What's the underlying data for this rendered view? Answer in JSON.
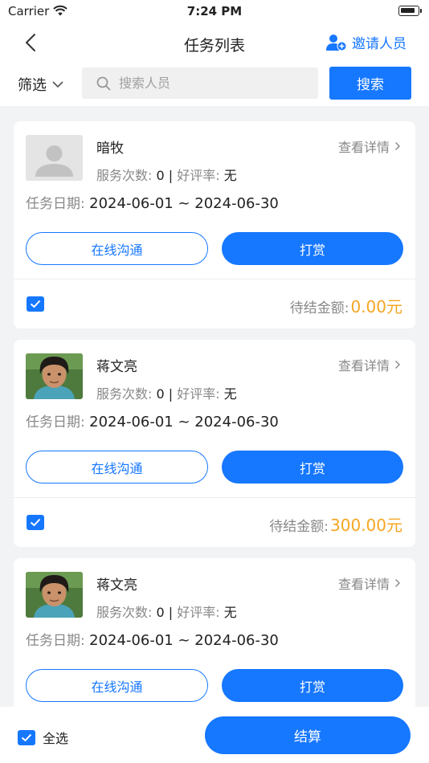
{
  "status_bar": {
    "carrier": "Carrier",
    "time": "7:24 PM"
  },
  "nav": {
    "title": "任务列表",
    "invite_label": "邀请人员"
  },
  "search": {
    "filter_label": "筛选",
    "placeholder": "搜索人员",
    "button_label": "搜索"
  },
  "cards": [
    {
      "name": "暗牧",
      "avatar": "placeholder-avatar",
      "detail_label": "查看详情",
      "stats_service_label": "服务次数:",
      "service_count": "0",
      "separator": "|",
      "stats_rating_label": "好评率:",
      "rating": "无",
      "date_label": "任务日期:",
      "date_range": "2024-06-01 ~ 2024-06-30",
      "chat_label": "在线沟通",
      "reward_label": "打赏",
      "amount_label": "待结金额:",
      "amount": "0.00元",
      "checked": true
    },
    {
      "name": "蒋文亮",
      "avatar": "photo-avatar",
      "detail_label": "查看详情",
      "stats_service_label": "服务次数:",
      "service_count": "0",
      "separator": "|",
      "stats_rating_label": "好评率:",
      "rating": "无",
      "date_label": "任务日期:",
      "date_range": "2024-06-01 ~ 2024-06-30",
      "chat_label": "在线沟通",
      "reward_label": "打赏",
      "amount_label": "待结金额:",
      "amount": "300.00元",
      "checked": true
    },
    {
      "name": "蒋文亮",
      "avatar": "photo-avatar",
      "detail_label": "查看详情",
      "stats_service_label": "服务次数:",
      "service_count": "0",
      "separator": "|",
      "stats_rating_label": "好评率:",
      "rating": "无",
      "date_label": "任务日期:",
      "date_range": "2024-06-01 ~ 2024-06-30",
      "chat_label": "在线沟通",
      "reward_label": "打赏"
    }
  ],
  "bottom": {
    "select_all_label": "全选",
    "settle_label": "结算"
  },
  "colors": {
    "primary": "#1677ff",
    "amount": "#f5a623",
    "background": "#f2f3f5"
  }
}
